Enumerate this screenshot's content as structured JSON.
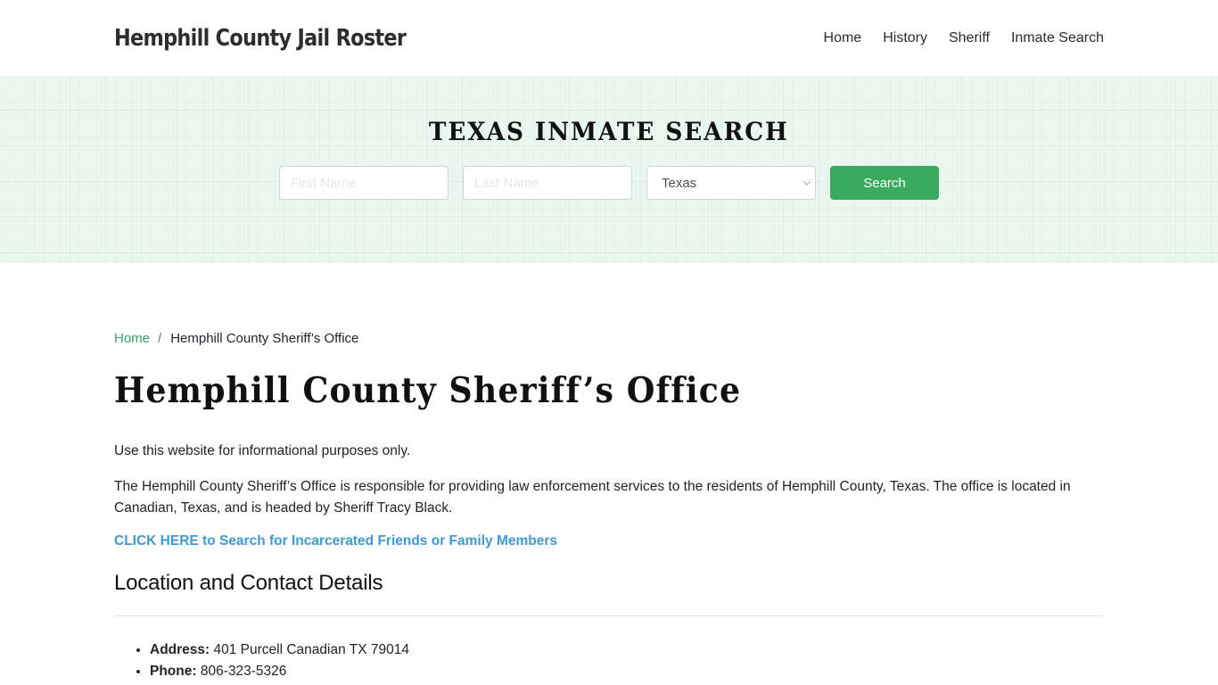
{
  "header": {
    "brand": "Hemphill County Jail Roster",
    "nav": [
      {
        "label": "Home"
      },
      {
        "label": "History"
      },
      {
        "label": "Sheriff"
      },
      {
        "label": "Inmate Search"
      }
    ]
  },
  "banner": {
    "title": "TEXAS INMATE SEARCH",
    "first_name_placeholder": "First Name",
    "first_name_value": "",
    "last_name_placeholder": "Last Name",
    "last_name_value": "",
    "state_selected": "Texas",
    "search_button": "Search",
    "accent_color": "#3aaa5f"
  },
  "breadcrumb": {
    "home": "Home",
    "separator": "/",
    "current": "Hemphill County Sheriff’s Office"
  },
  "main": {
    "title": "Hemphill County Sheriff’s Office",
    "disclaimer": "Use this website for informational purposes only.",
    "description": "The Hemphill County Sheriff’s Office is responsible for providing law enforcement services to the residents of Hemphill County, Texas. The office is located in Canadian, Texas, and is headed by Sheriff Tracy Black.",
    "cta_link": "CLICK HERE to Search for Incarcerated Friends or Family Members",
    "section_title": "Location and Contact Details",
    "details": [
      {
        "label": "Address:",
        "value": " 401 Purcell Canadian TX 79014"
      },
      {
        "label": "Phone:",
        "value": " 806-323-5326"
      }
    ]
  }
}
